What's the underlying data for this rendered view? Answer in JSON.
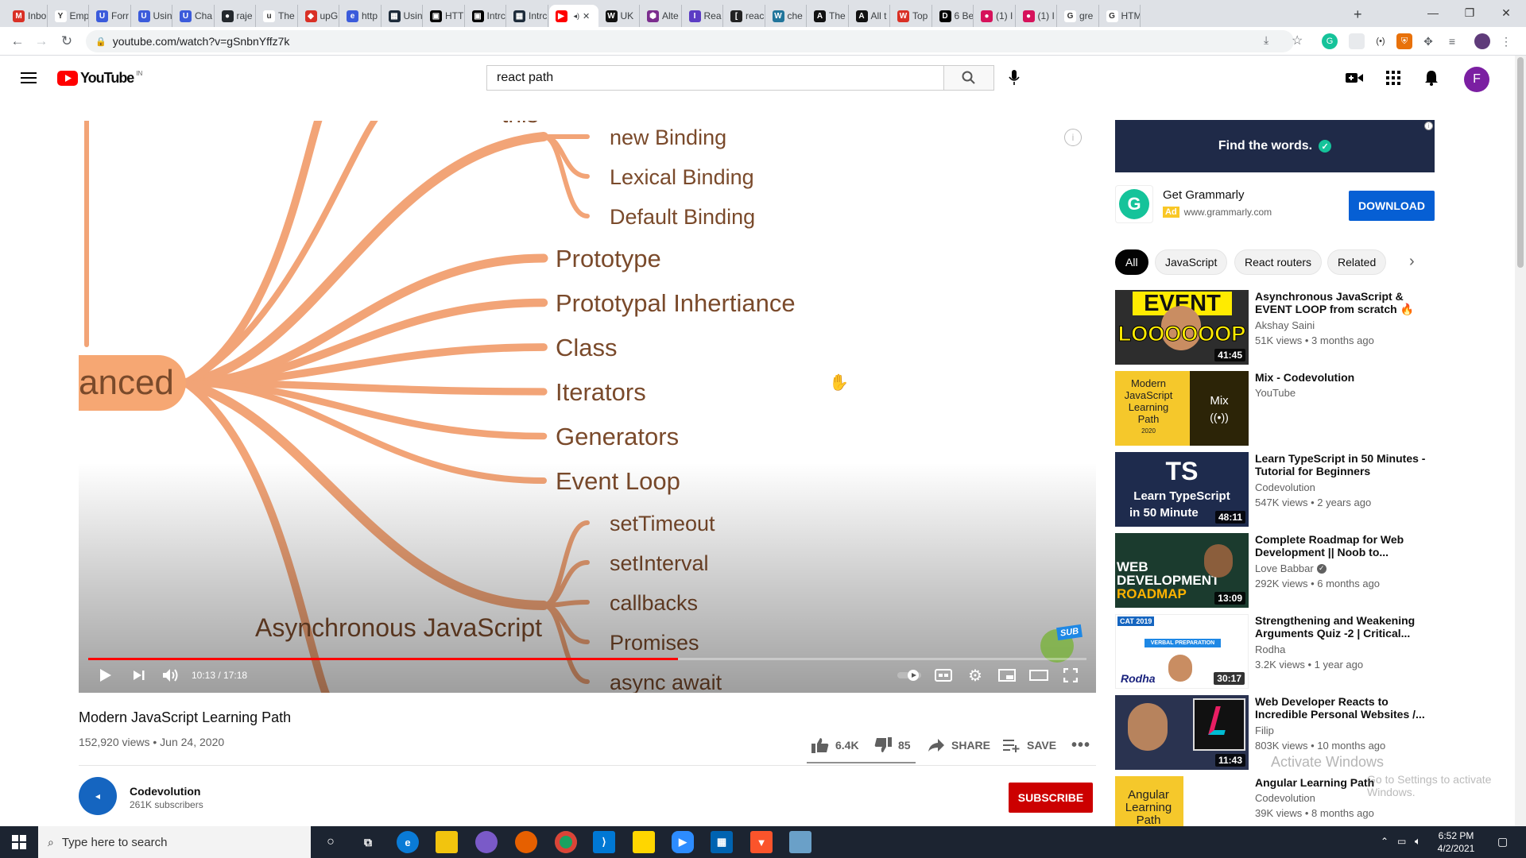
{
  "browser": {
    "tabs": [
      {
        "label": "Inbo",
        "fav_color": "#d93025",
        "fav_glyph": "M"
      },
      {
        "label": "Emp",
        "fav_color": "#fff",
        "fav_glyph": "Y"
      },
      {
        "label": "Forr",
        "fav_color": "#3b5bdb",
        "fav_glyph": "U"
      },
      {
        "label": "Usin",
        "fav_color": "#3b5bdb",
        "fav_glyph": "U"
      },
      {
        "label": "Cha",
        "fav_color": "#3b5bdb",
        "fav_glyph": "U"
      },
      {
        "label": "raje",
        "fav_color": "#24292e",
        "fav_glyph": "●"
      },
      {
        "label": "The",
        "fav_color": "#fff",
        "fav_glyph": "u"
      },
      {
        "label": "upG",
        "fav_color": "#d93025",
        "fav_glyph": "◆"
      },
      {
        "label": "http",
        "fav_color": "#3b5bdb",
        "fav_glyph": "e"
      },
      {
        "label": "Usin",
        "fav_color": "#1d2b3a",
        "fav_glyph": "▦"
      },
      {
        "label": "HTT",
        "fav_color": "#000",
        "fav_glyph": "▣"
      },
      {
        "label": "Intrc",
        "fav_color": "#000",
        "fav_glyph": "▣"
      },
      {
        "label": "Intrc",
        "fav_color": "#1d2b3a",
        "fav_glyph": "▦"
      },
      {
        "label": "",
        "fav_color": "#ff0000",
        "fav_glyph": "▶",
        "active": true
      },
      {
        "label": "UK",
        "fav_color": "#111",
        "fav_glyph": "W"
      },
      {
        "label": "Alte",
        "fav_color": "#7b2d8e",
        "fav_glyph": "⬢"
      },
      {
        "label": "Rea",
        "fav_color": "#5b3cc4",
        "fav_glyph": "I"
      },
      {
        "label": "reac",
        "fav_color": "#222",
        "fav_glyph": "["
      },
      {
        "label": "che",
        "fav_color": "#21759b",
        "fav_glyph": "W"
      },
      {
        "label": "The",
        "fav_color": "#111",
        "fav_glyph": "A"
      },
      {
        "label": "All t",
        "fav_color": "#111",
        "fav_glyph": "A"
      },
      {
        "label": "Top",
        "fav_color": "#d93025",
        "fav_glyph": "W"
      },
      {
        "label": "6 Be",
        "fav_color": "#000",
        "fav_glyph": "D"
      },
      {
        "label": "(1) I",
        "fav_color": "#d6125b",
        "fav_glyph": "●"
      },
      {
        "label": "(1) I",
        "fav_color": "#d6125b",
        "fav_glyph": "●"
      },
      {
        "label": "gre",
        "fav_color": "#fff",
        "fav_glyph": "G"
      },
      {
        "label": "HTM",
        "fav_color": "#fff",
        "fav_glyph": "G"
      }
    ],
    "new_tab": "+",
    "minimize": "—",
    "maximize": "❐",
    "close": "✕",
    "url": "youtube.com/watch?v=gSnbnYffz7k"
  },
  "youtube": {
    "logo_text": "YouTube",
    "logo_country": "IN",
    "search_value": "react path",
    "avatar_letter": "F",
    "accent": "#ff0000"
  },
  "player": {
    "time_current": "10:13",
    "time_total": "17:18",
    "progress": 0.5905,
    "info_glyph": "i",
    "frame": {
      "root_label": "anced",
      "top_partial": "this",
      "sub_top": [
        "new Binding",
        "Lexical Binding",
        "Default Binding"
      ],
      "main": [
        "Prototype",
        "Prototypal Inhertiance",
        "Class",
        "Iterators",
        "Generators",
        "Event Loop"
      ],
      "sub_bottom": [
        "setTimeout",
        "setInterval",
        "callbacks",
        "Promises",
        "async await"
      ],
      "group_label": "Asynchronous JavaScript",
      "sub_badge": "SUB"
    }
  },
  "video": {
    "title": "Modern JavaScript Learning Path",
    "views": "152,920 views • Jun 24, 2020",
    "likes": "6.4K",
    "dislikes": "85",
    "share": "SHARE",
    "save": "SAVE",
    "channel": "Codevolution",
    "subscribers": "261K subscribers",
    "subscribe": "SUBSCRIBE"
  },
  "sidebar": {
    "ad_banner": "Find the words.",
    "ad_title": "Get Grammarly",
    "ad_badge": "Ad",
    "ad_url": "www.grammarly.com",
    "ad_button": "DOWNLOAD",
    "chips": [
      "All",
      "JavaScript",
      "React routers",
      "Related"
    ],
    "chips_next": "›",
    "recommendations": [
      {
        "title": "Asynchronous JavaScript & EVENT LOOP from scratch 🔥 |...",
        "channel": "Akshay Saini",
        "meta": "51K views • 3 months ago",
        "duration": "41:45",
        "thumb": "event"
      },
      {
        "title": "Mix - Codevolution",
        "channel": "YouTube",
        "meta": "",
        "duration": "",
        "thumb": "mix",
        "mix_label": "Mix",
        "mix_thumb_text": [
          "Modern",
          "JavaScript",
          "Learning",
          "Path",
          "2020"
        ]
      },
      {
        "title": "Learn TypeScript in 50 Minutes - Tutorial for Beginners",
        "channel": "Codevolution",
        "meta": "547K views • 2 years ago",
        "duration": "48:11",
        "thumb": "ts",
        "thumb_text": [
          "TS",
          "Learn TypeScript",
          "in 50 Minute"
        ]
      },
      {
        "title": "Complete Roadmap for Web Development || Noob to...",
        "channel": "Love Babbar",
        "meta": "292K views • 6 months ago",
        "duration": "13:09",
        "thumb": "web",
        "thumb_text": [
          "WEB",
          "DEVELOPMENT",
          "ROADMAP"
        ],
        "verified": true
      },
      {
        "title": "Strengthening and Weakening Arguments Quiz -2 | Critical...",
        "channel": "Rodha",
        "meta": "3.2K views • 1 year ago",
        "duration": "30:17",
        "thumb": "cat",
        "thumb_text": [
          "CAT 2019",
          "VERBAL PREPARATION",
          "Rodha"
        ]
      },
      {
        "title": "Web Developer Reacts to Incredible Personal Websites /...",
        "channel": "Filip",
        "meta": "803K views • 10 months ago",
        "duration": "11:43",
        "thumb": "filip"
      },
      {
        "title": "Angular Learning Path",
        "channel": "Codevolution",
        "meta": "39K views • 8 months ago",
        "duration": "",
        "thumb": "angular",
        "thumb_text": [
          "Angular",
          "Learning",
          "Path"
        ]
      }
    ]
  },
  "windows": {
    "search_placeholder": "Type here to search",
    "time": "6:52 PM",
    "date": "4/2/2021",
    "activate_title": "Activate Windows",
    "activate_sub": "Go to Settings to activate Windows."
  }
}
